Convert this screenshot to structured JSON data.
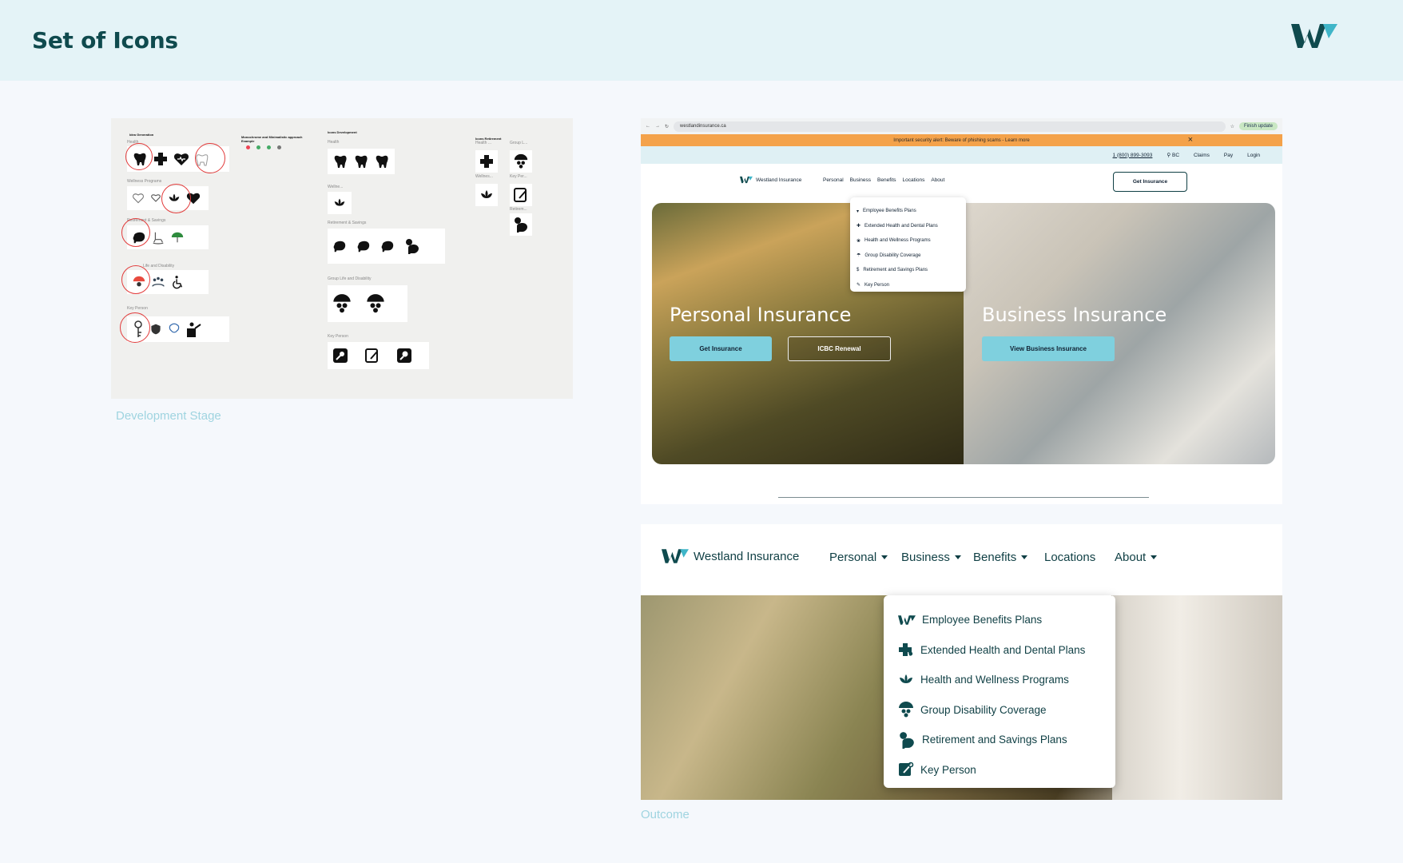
{
  "page": {
    "title": "Set of Icons",
    "dev_caption": "Development Stage",
    "outcome_caption": "Outcome"
  },
  "colors": {
    "brand": "#0f4a4e",
    "accent": "#7fd0de",
    "alert": "#f4a24a"
  },
  "dev_board": {
    "headings": {
      "idea": "Idea Generation",
      "mono": "Monochrome and Minimalistic approach Example",
      "icons_dev": "Icons Development",
      "icons_ret": "Icons Retirement"
    },
    "labels": {
      "health": "Health",
      "wellness": "Wellness Programs",
      "retirement": "Retirement & Savings",
      "life": "Life and Disability",
      "key": "Key Person",
      "health2": "Health",
      "wellne": "Wellne...",
      "retirement2": "Retirement & Savings",
      "group_life": "Group Life and Disability",
      "key2": "Key Person",
      "health3": "Health ...",
      "group3": "Group L...",
      "wellnes3": "Wellnes...",
      "keyper3": "Key Per...",
      "retirem3": "Retirem..."
    }
  },
  "browser": {
    "url": "westlandinsurance.ca",
    "finish": "Finish update",
    "alert": "Important security alert: Beware of phishing scams - Learn more",
    "phone": "1 (800) 899-3093",
    "region": "BC",
    "claims": "Claims",
    "pay": "Pay",
    "login": "Login",
    "brand": "Westland Insurance",
    "nav": [
      "Personal",
      "Business",
      "Benefits",
      "Locations",
      "About"
    ],
    "cta": "Get Insurance",
    "personal_title": "Personal Insurance",
    "personal_btn": "Get Insurance",
    "icbc_btn": "ICBC Renewal",
    "business_title": "Business Insurance",
    "business_btn": "View Business Insurance"
  },
  "benefits_menu": [
    {
      "label": "Employee Benefits Plans",
      "icon": "w-logo-icon"
    },
    {
      "label": "Extended Health and Dental Plans",
      "icon": "health-cross-icon"
    },
    {
      "label": "Health and Wellness Programs",
      "icon": "lotus-icon"
    },
    {
      "label": "Group Disability Coverage",
      "icon": "umbrella-group-icon"
    },
    {
      "label": "Retirement and Savings Plans",
      "icon": "piggy-bank-icon"
    },
    {
      "label": "Key Person",
      "icon": "key-document-icon"
    }
  ],
  "outcome_nav": {
    "brand": "Westland Insurance",
    "items": [
      "Personal",
      "Business",
      "Benefits",
      "Locations",
      "About"
    ]
  }
}
